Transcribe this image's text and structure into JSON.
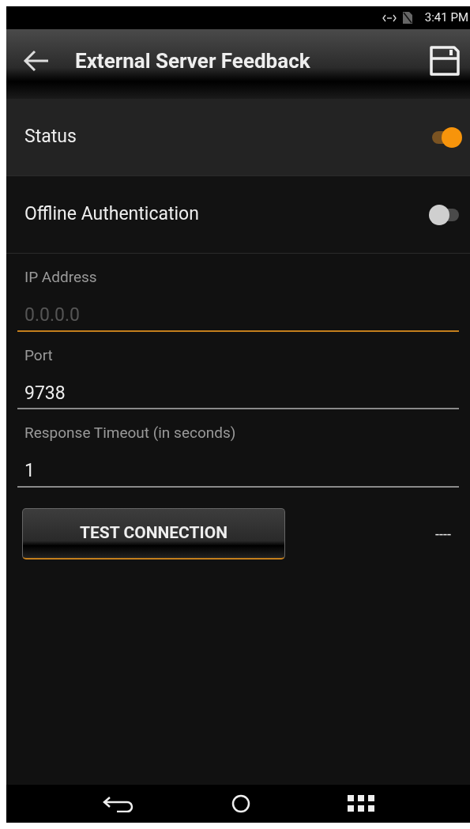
{
  "status_bar": {
    "time": "3:41 PM"
  },
  "header": {
    "title": "External Server Feedback"
  },
  "toggles": [
    {
      "label": "Status",
      "on": true,
      "highlighted": true
    },
    {
      "label": "Offline Authentication",
      "on": false,
      "highlighted": false
    }
  ],
  "fields": [
    {
      "label": "IP Address",
      "placeholder": "0.0.0.0",
      "focused": true
    },
    {
      "label": "Port",
      "value": "9738",
      "focused": false
    },
    {
      "label": "Response Timeout (in seconds)",
      "value": "1",
      "focused": false
    }
  ],
  "test_button": {
    "label": "TEST CONNECTION"
  },
  "result": "----"
}
